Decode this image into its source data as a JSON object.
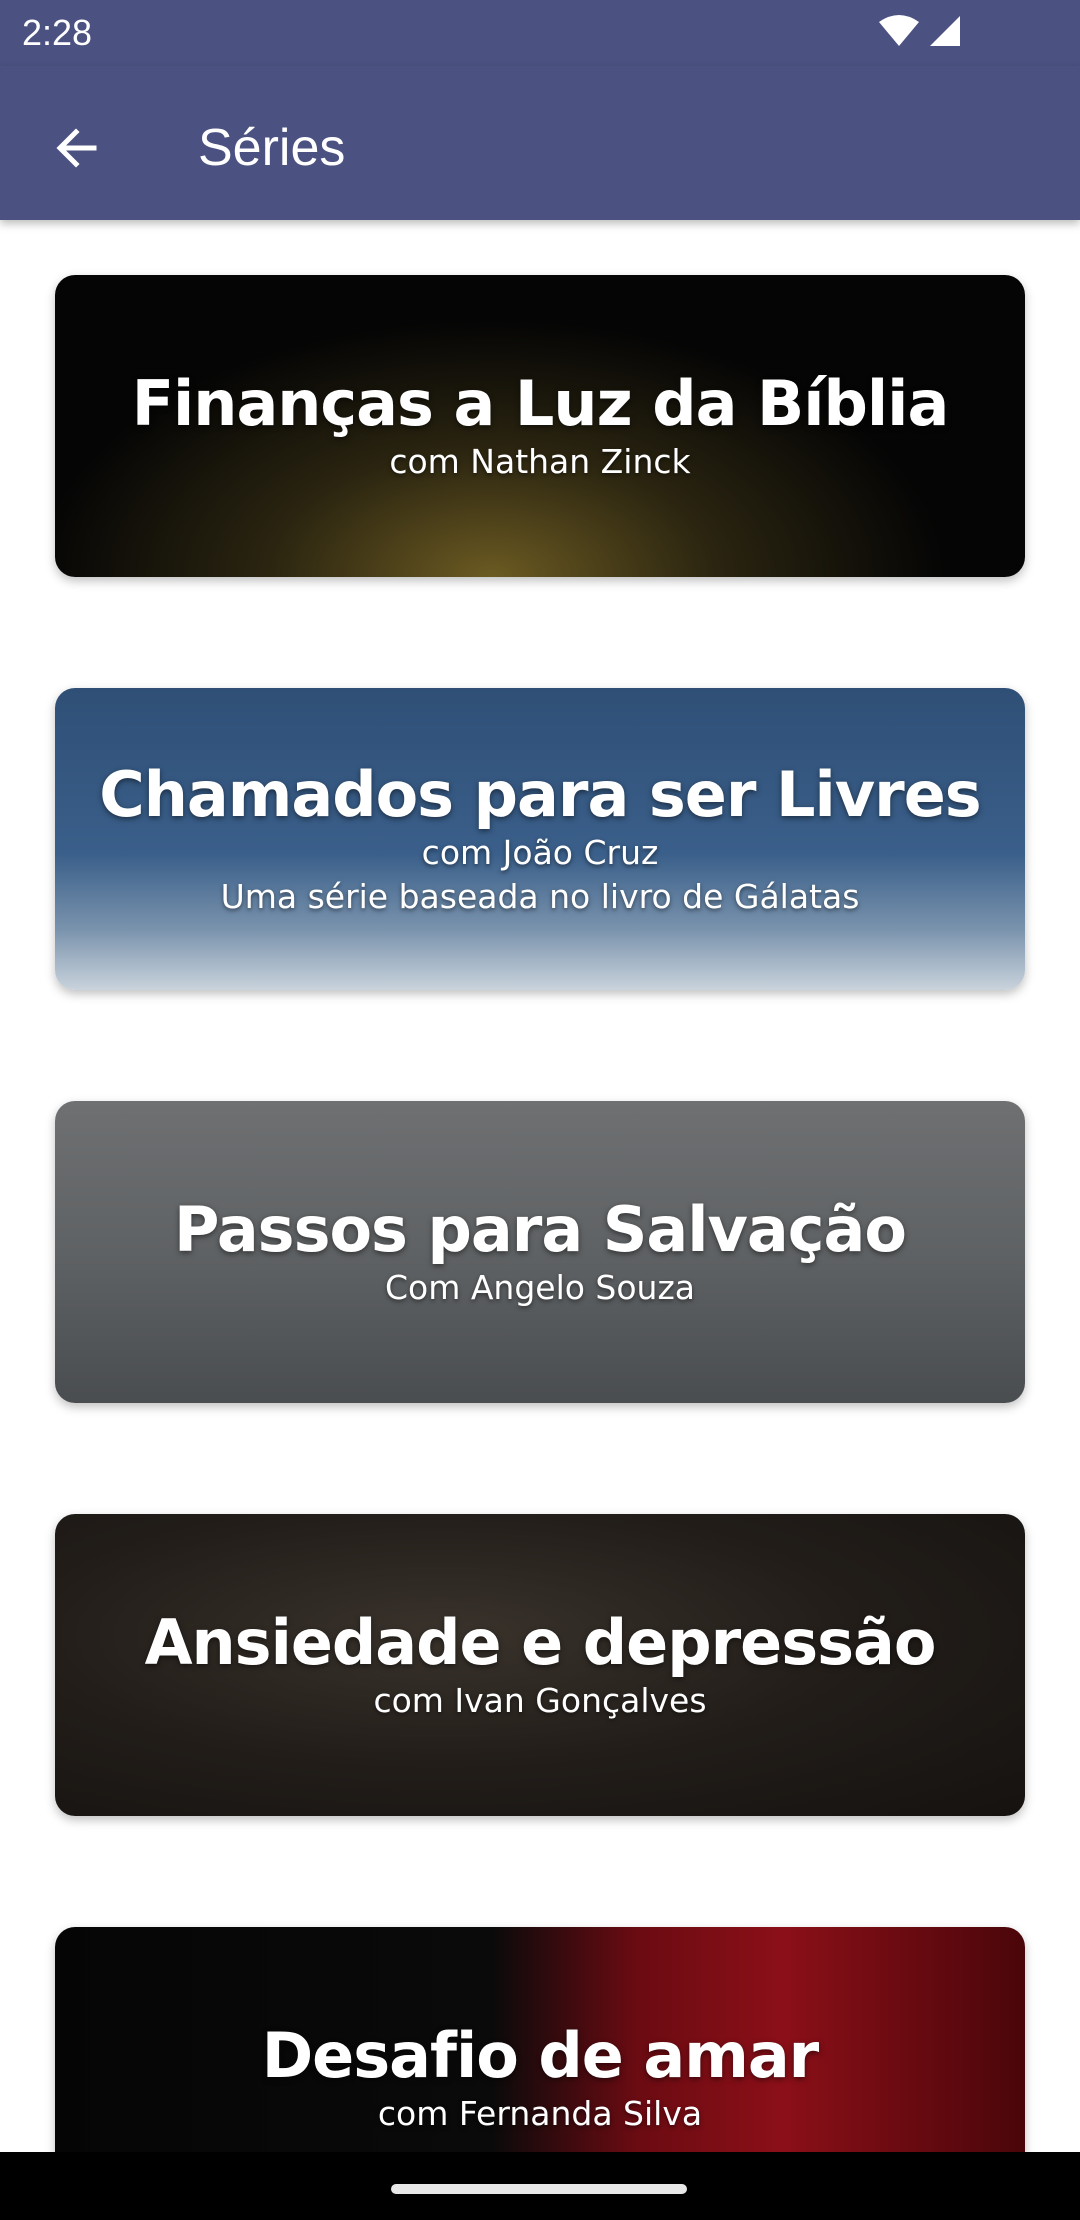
{
  "status_bar": {
    "time": "2:28"
  },
  "app_bar": {
    "title": "Séries"
  },
  "series": [
    {
      "title": "Finanças a Luz da Bíblia",
      "subtitle": "com Nathan Zinck",
      "extra": ""
    },
    {
      "title": "Chamados para ser Livres",
      "subtitle": "com João Cruz",
      "extra": "Uma série baseada no livro de Gálatas"
    },
    {
      "title": "Passos para Salvação",
      "subtitle": "Com Angelo Souza",
      "extra": ""
    },
    {
      "title": "Ansiedade e depressão",
      "subtitle": "com Ivan Gonçalves",
      "extra": ""
    },
    {
      "title": "Desafio de amar",
      "subtitle": "com Fernanda Silva",
      "extra": ""
    }
  ],
  "colors": {
    "app_bar": "#4b5180",
    "text_on_bar": "#ffffff"
  },
  "icons": {
    "back": "arrow-left-icon",
    "wifi": "wifi-icon",
    "signal": "signal-icon"
  }
}
